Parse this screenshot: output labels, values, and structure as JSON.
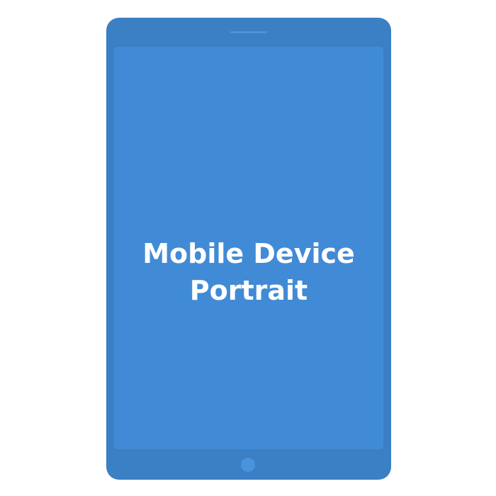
{
  "screen": {
    "line1": "Mobile Device",
    "line2": "Portrait"
  },
  "colors": {
    "device_body": "#3b7fc4",
    "screen": "#418bd6",
    "text": "#ffffff"
  }
}
